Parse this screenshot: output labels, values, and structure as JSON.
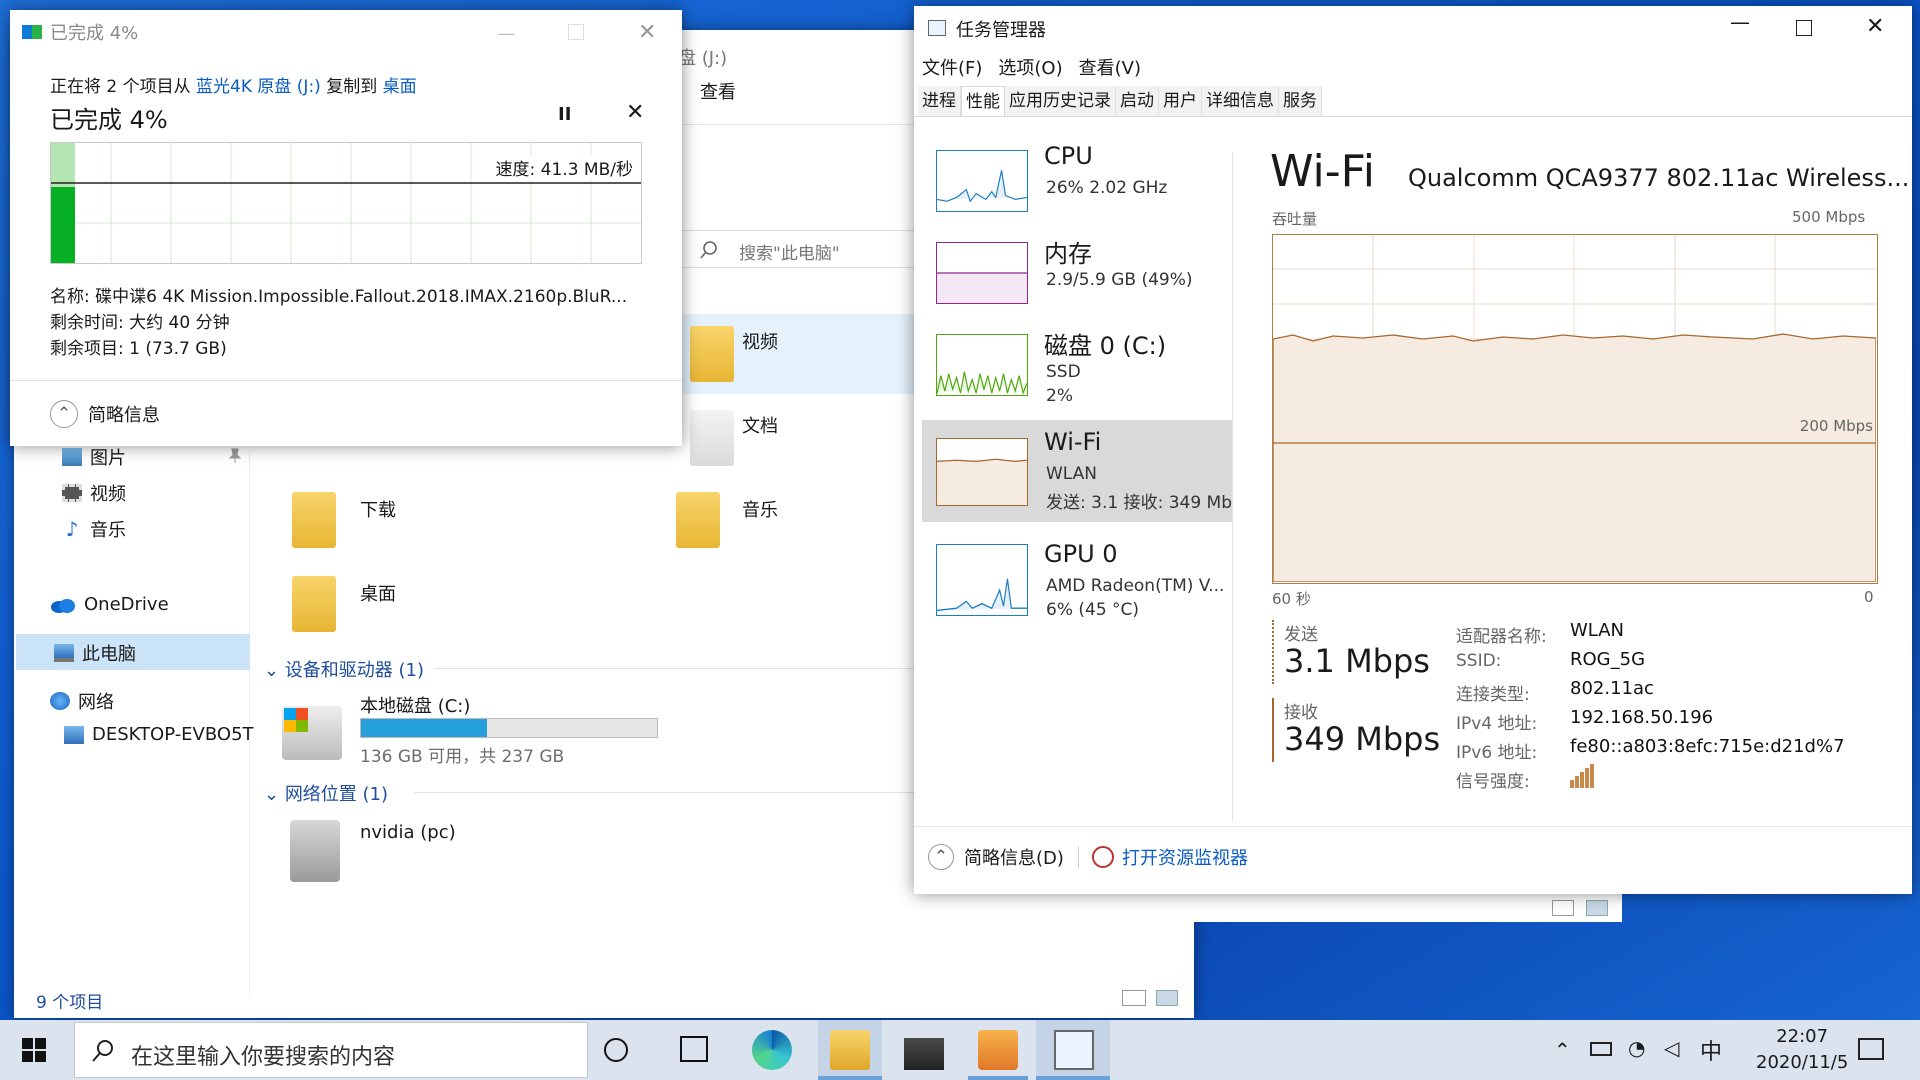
{
  "explorer": {
    "title_path": "盘 (J:)",
    "ribbon_tab": "查看",
    "search_placeholder": "搜索\"此电脑\"",
    "nav": {
      "pictures": "图片",
      "videos": "视频",
      "music": "音乐",
      "onedrive": "OneDrive",
      "this_pc": "此电脑",
      "network": "网络",
      "desktop_pc": "DESKTOP-EVBO5T"
    },
    "folders": {
      "videos": "视频",
      "documents": "文档",
      "downloads": "下载",
      "music": "音乐",
      "desktop": "桌面"
    },
    "devices_group": "设备和驱动器 (1)",
    "drive": {
      "name": "本地磁盘 (C:)",
      "space": "136 GB 可用，共 237 GB",
      "used_fraction": 0.426
    },
    "network_group": "网络位置 (1)",
    "network_item": "nvidia (pc)",
    "status": "9 个项目"
  },
  "copy_dialog": {
    "title": "已完成 4%",
    "line1_prefix": "正在将 2 个项目从",
    "source": "蓝光4K 原盘 (J:)",
    "line1_mid": "复制到",
    "dest": "桌面",
    "heading": "已完成 4%",
    "speed": "速度: 41.3 MB/秒",
    "progress_fraction": 0.04,
    "name_row": "名称: 碟中谍6 4K Mission.Impossible.Fallout.2018.IMAX.2160p.BluR...",
    "time_row": "剩余时间: 大约 40 分钟",
    "items_row": "剩余项目: 1 (73.7 GB)",
    "less_details": "简略信息"
  },
  "task_manager": {
    "title": "任务管理器",
    "menu": [
      "文件(F)",
      "选项(O)",
      "查看(V)"
    ],
    "tabs": [
      "进程",
      "性能",
      "应用历史记录",
      "启动",
      "用户",
      "详细信息",
      "服务"
    ],
    "active_tab": 1,
    "side": {
      "cpu": {
        "title": "CPU",
        "sub1": "26% 2.02 GHz"
      },
      "mem": {
        "title": "内存",
        "sub1": "2.9/5.9 GB (49%)"
      },
      "disk": {
        "title": "磁盘 0 (C:)",
        "sub1": "SSD",
        "sub2": "2%"
      },
      "wifi": {
        "title": "Wi-Fi",
        "sub1": "WLAN",
        "sub2": "发送: 3.1 接收: 349 Mb"
      },
      "gpu": {
        "title": "GPU 0",
        "sub1": "AMD Radeon(TM) V...",
        "sub2": "6% (45 °C)"
      }
    },
    "detail": {
      "title": "Wi-Fi",
      "adapter": "Qualcomm QCA9377 802.11ac Wireless...",
      "throughput_label": "吞吐量",
      "max_label": "500 Mbps",
      "mid_label": "200 Mbps",
      "x_left": "60 秒",
      "x_right": "0",
      "send_label": "发送",
      "send_value": "3.1 Mbps",
      "recv_label": "接收",
      "recv_value": "349 Mbps",
      "info": [
        {
          "k": "适配器名称:",
          "v": "WLAN"
        },
        {
          "k": "SSID:",
          "v": "ROG_5G"
        },
        {
          "k": "连接类型:",
          "v": "802.11ac"
        },
        {
          "k": "IPv4 地址:",
          "v": "192.168.50.196"
        },
        {
          "k": "IPv6 地址:",
          "v": "fe80::a803:8efc:715e:d21d%7"
        },
        {
          "k": "信号强度:",
          "v": ""
        }
      ]
    },
    "fewer_details": "简略信息(D)",
    "open_monitor": "打开资源监视器"
  },
  "taskbar": {
    "search_placeholder": "在这里输入你要搜索的内容",
    "ime": "中",
    "time": "22:07",
    "date": "2020/11/5"
  },
  "colors": {
    "accent": "#0078d7",
    "progress_green": "#06b025",
    "wifi_graph": "#a7682f",
    "cpu_graph": "#1a7fc1",
    "mem_graph": "#8b2a8b",
    "disk_graph": "#4da60c"
  }
}
